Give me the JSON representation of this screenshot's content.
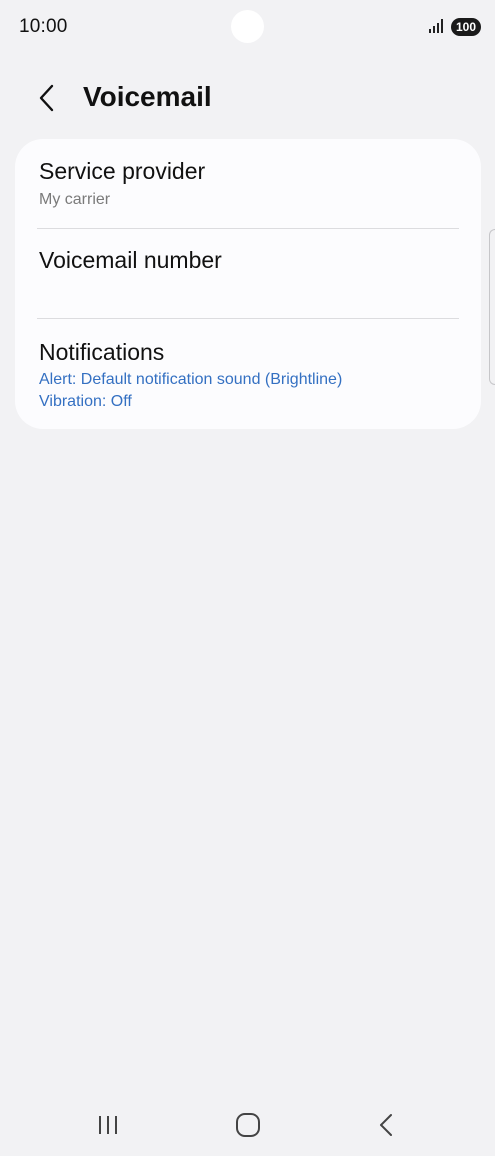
{
  "status_bar": {
    "time": "10:00",
    "battery": "100",
    "icons": [
      "signal-icon",
      "battery-icon"
    ]
  },
  "header": {
    "title": "Voicemail",
    "back_icon": "chevron-left-icon"
  },
  "settings": {
    "service_provider": {
      "title": "Service provider",
      "subtitle": "My carrier"
    },
    "voicemail_number": {
      "title": "Voicemail number"
    },
    "notifications": {
      "title": "Notifications",
      "alert": "Alert: Default notification sound (Brightline)",
      "vibration": "Vibration: Off"
    }
  },
  "nav_bar": {
    "icons": [
      "recents-icon",
      "home-icon",
      "back-icon"
    ]
  },
  "colors": {
    "background": "#f2f2f4",
    "card": "#fcfcfe",
    "accent_text": "#3470c2",
    "secondary_text": "#7a7a7a"
  }
}
